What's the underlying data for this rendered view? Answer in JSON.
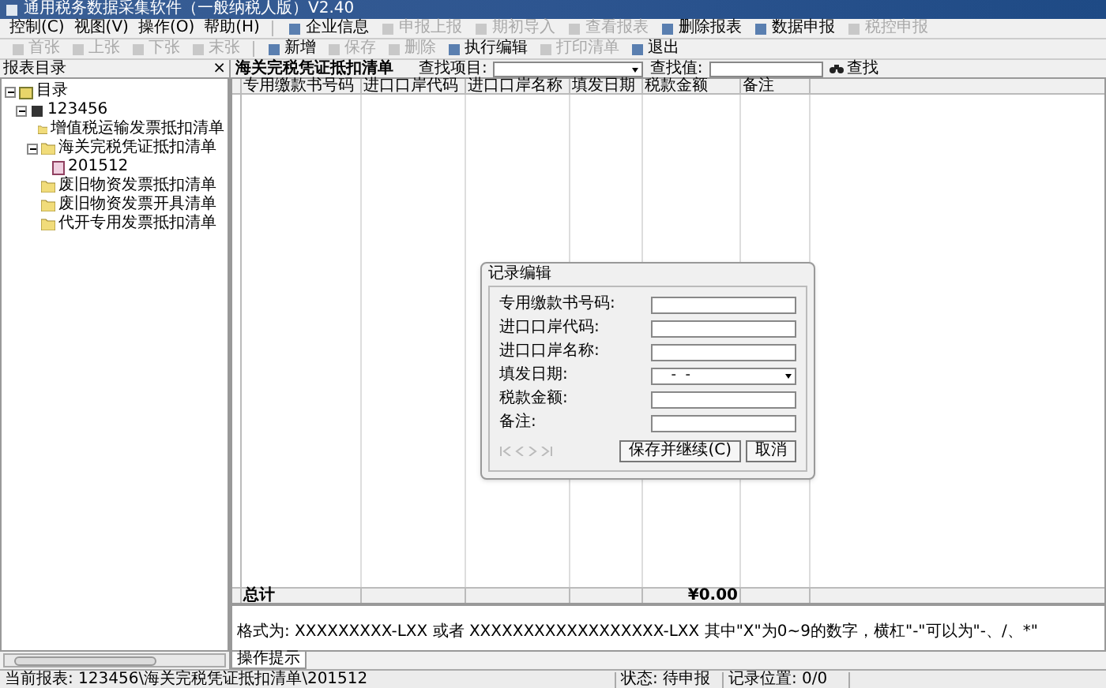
{
  "window": {
    "title": "通用税务数据采集软件（一般纳税人版）V2.40"
  },
  "menu": [
    "控制(C)",
    "视图(V)",
    "操作(O)",
    "帮助(H)"
  ],
  "toolbar_1": [
    {
      "label": "企业信息",
      "disabled": false
    },
    {
      "label": "申报上报",
      "disabled": true
    },
    {
      "label": "期初导入",
      "disabled": true
    },
    {
      "label": "查看报表",
      "disabled": true
    },
    {
      "label": "删除报表",
      "disabled": false
    },
    {
      "label": "数据申报",
      "disabled": false
    },
    {
      "label": "税控申报",
      "disabled": true
    }
  ],
  "toolbar_2": [
    {
      "label": "首张",
      "disabled": true
    },
    {
      "label": "上张",
      "disabled": true
    },
    {
      "label": "下张",
      "disabled": true
    },
    {
      "label": "末张",
      "disabled": true
    },
    {
      "label": "新增",
      "disabled": false
    },
    {
      "label": "保存",
      "disabled": true
    },
    {
      "label": "删除",
      "disabled": true
    },
    {
      "label": "执行编辑",
      "disabled": false
    },
    {
      "label": "打印清单",
      "disabled": true
    },
    {
      "label": "退出",
      "disabled": false
    }
  ],
  "sidebar": {
    "title": "报表目录",
    "close": "×",
    "tree": [
      {
        "label": "目录",
        "kind": "root",
        "expanded": true,
        "children": [
          {
            "label": "123456",
            "kind": "company",
            "expanded": true,
            "children": [
              {
                "label": "增值税运输发票抵扣清单",
                "kind": "folder"
              },
              {
                "label": "海关完税凭证抵扣清单",
                "kind": "folder",
                "expanded": true,
                "children": [
                  {
                    "label": "201512",
                    "kind": "report"
                  }
                ]
              },
              {
                "label": "废旧物资发票抵扣清单",
                "kind": "folder"
              },
              {
                "label": "废旧物资发票开具清单",
                "kind": "folder"
              },
              {
                "label": "代开专用发票抵扣清单",
                "kind": "folder"
              }
            ]
          }
        ]
      }
    ]
  },
  "main": {
    "title": "海关完税凭证抵扣清单",
    "search_item_label": "查找项目:",
    "search_value_label": "查找值:",
    "search_button": "查找",
    "table": {
      "columns": [
        "专用缴款书号码",
        "进口口岸代码",
        "进口口岸名称",
        "填发日期",
        "税款金额",
        "备注"
      ],
      "total_label": "总计",
      "total_amount": "¥0.00"
    },
    "hint": "格式为: XXXXXXXXX-LXX 或者 XXXXXXXXXXXXXXXXXX-LXX  其中\"X\"为0~9的数字，横杠\"-\"可以为\"-、/、*\"",
    "tabs": [
      {
        "label": "操作提示",
        "selected": true
      }
    ]
  },
  "dialog": {
    "title": "记录编辑",
    "fields": [
      {
        "label": "专用缴款书号码:",
        "kind": "text"
      },
      {
        "label": "进口口岸代码:",
        "kind": "text"
      },
      {
        "label": "进口口岸名称:",
        "kind": "text"
      },
      {
        "label": "填发日期:",
        "kind": "date",
        "value": "  -  -"
      },
      {
        "label": "税款金额:",
        "kind": "text"
      },
      {
        "label": "备注:",
        "kind": "text"
      }
    ],
    "buttons": [
      "保存并继续(C)",
      "取消"
    ]
  },
  "status_bar": [
    "当前报表: 123456\\海关完税凭证抵扣清单\\201512",
    "状态: 待申报",
    "记录位置: 0/0"
  ]
}
